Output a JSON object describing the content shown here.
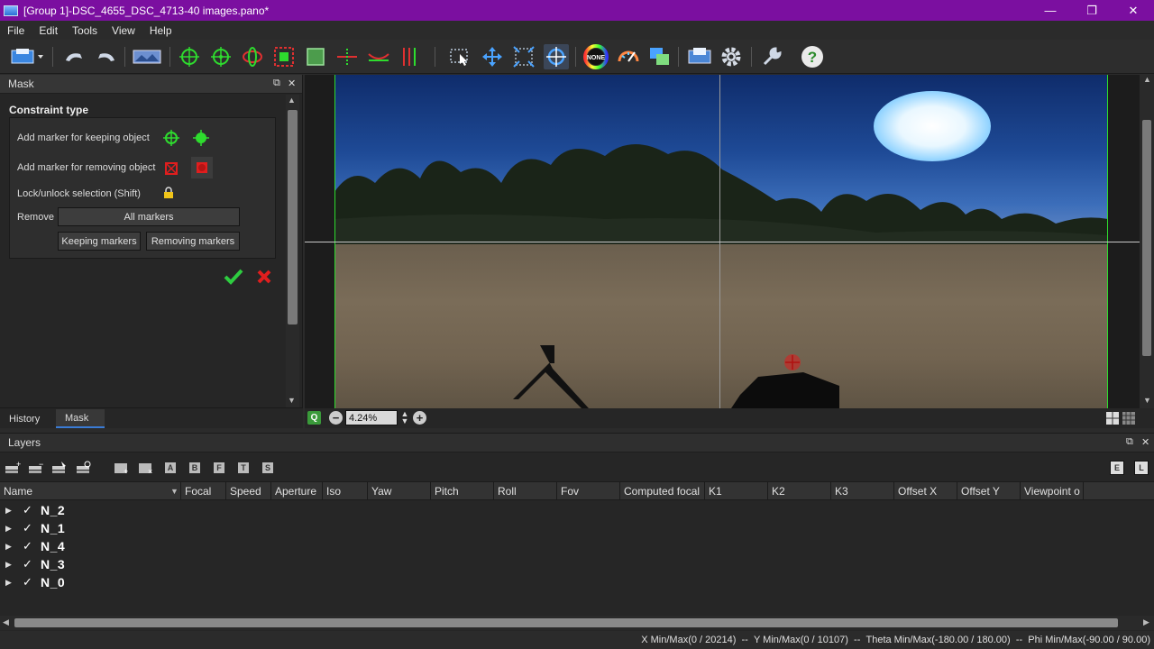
{
  "window": {
    "title": "[Group 1]-DSC_4655_DSC_4713-40 images.pano*",
    "minimize": "—",
    "maximize": "❐",
    "close": "✕"
  },
  "menu": [
    "File",
    "Edit",
    "Tools",
    "View",
    "Help"
  ],
  "toolbar": {
    "icons": [
      "open-project-icon",
      "undo-icon",
      "redo-icon",
      "panorama-preview-icon",
      "add-keep-marker-icon",
      "add-keep-marker-alt-icon",
      "rotate-icon",
      "remove-marker-icon",
      "crop-icon",
      "horizon-icon",
      "straighten-icon",
      "vertical-lines-icon",
      "select-icon",
      "move-icon",
      "scale-icon",
      "target-icon",
      "none-color-icon",
      "gauge-icon",
      "blend-icon",
      "stitch-icon",
      "settings-icon",
      "tools-icon",
      "help-icon"
    ],
    "none_label": "NONE"
  },
  "mask_panel": {
    "title": "Mask",
    "constraint_title": "Constraint type",
    "keep_label": "Add marker for keeping object",
    "remove_label": "Add marker for removing object",
    "lock_label": "Lock/unlock selection (Shift)",
    "remove_row_label": "Remove",
    "all_markers": "All markers",
    "keeping_markers": "Keeping markers",
    "removing_markers": "Removing markers",
    "tabs": [
      "History",
      "Mask"
    ],
    "active_tab": "Mask"
  },
  "viewer": {
    "zoom": "4.24%"
  },
  "layers": {
    "title": "Layers",
    "columns": [
      "Name",
      "Focal",
      "Speed",
      "Aperture",
      "Iso",
      "Yaw",
      "Pitch",
      "Roll",
      "Fov",
      "Computed focal",
      "K1",
      "K2",
      "K3",
      "Offset X",
      "Offset Y",
      "Viewpoint o"
    ],
    "rows": [
      "N_2",
      "N_1",
      "N_4",
      "N_3",
      "N_0"
    ],
    "tool_letters": [
      "A",
      "B",
      "F",
      "T",
      "S"
    ],
    "right_tools": [
      "E",
      "L"
    ]
  },
  "status": {
    "x": "X Min/Max(0 / 20214)",
    "y": "Y Min/Max(0 / 10107)",
    "theta": "Theta Min/Max(-180.00 / 180.00)",
    "phi": "Phi Min/Max(-90.00 / 90.00)",
    "sep": "  --  "
  },
  "colors": {
    "title_bar": "#7b0fa0",
    "keep_green": "#2edc2e",
    "remove_red": "#e01e1e",
    "accept": "#2ecc40",
    "cancel": "#e01e1e"
  }
}
